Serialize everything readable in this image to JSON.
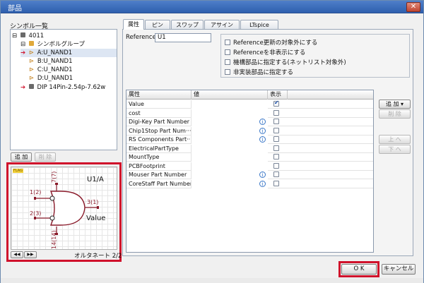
{
  "window": {
    "title": "部品",
    "close_label": "✕"
  },
  "left": {
    "symbol_list_label": "シンボル一覧",
    "tree": [
      {
        "text": "4011",
        "marker": "⊟",
        "icon_color": "#6a6a6a"
      },
      {
        "text": "シンボルグループ",
        "marker": "⊟",
        "icon_color": "#e0a93a"
      },
      {
        "text": "A:U_NAND1",
        "arrow": "➔",
        "selected": true
      },
      {
        "text": "B:U_NAND1"
      },
      {
        "text": "C:U_NAND1"
      },
      {
        "text": "D:U_NAND1"
      },
      {
        "text": "DIP 14Pin-2.54p-7.62w",
        "arrow": "➔"
      }
    ],
    "add_label": "追 加",
    "delete_label": "削 除",
    "preview": {
      "badge": "FLAG",
      "symbol_name": "U1/A",
      "value_label": "Value",
      "pin_top": "7(7)",
      "pin_in1": "1(2)",
      "pin_in2": "2(3)",
      "pin_out": "3(1)",
      "pin_bottom": "14(14)",
      "nav_prev": "◀◀",
      "nav_next": "▶▶",
      "alternate_label": "オルタネート 2/2"
    }
  },
  "tabs": [
    "属性",
    "ピン",
    "スワップ",
    "アサイン",
    "LTspice"
  ],
  "props": {
    "reference_label": "Reference",
    "reference_value": "U1",
    "options": [
      "Reference更新の対象外にする",
      "Referenceを非表示にする",
      "機構部品に指定する(ネットリスト対象外)",
      "非実装部品に指定する"
    ]
  },
  "grid": {
    "headers": [
      "属性",
      "値",
      "表示"
    ],
    "rows": [
      {
        "name": "Value",
        "info": false,
        "shown": true
      },
      {
        "name": "cost",
        "info": false,
        "shown": false
      },
      {
        "name": "Digi-Key Part Number",
        "info": true,
        "shown": false
      },
      {
        "name": "Chip1Stop Part Num···",
        "info": true,
        "shown": false
      },
      {
        "name": "RS Components Part···",
        "info": true,
        "shown": false
      },
      {
        "name": "ElectricalPartType",
        "info": false,
        "shown": false
      },
      {
        "name": "MountType",
        "info": false,
        "shown": false
      },
      {
        "name": "PCBFootprint",
        "info": false,
        "shown": false
      },
      {
        "name": "Mouser Part Number",
        "info": true,
        "shown": false
      },
      {
        "name": "CoreStaff Part Number",
        "info": true,
        "shown": false
      }
    ],
    "info_glyph": "i"
  },
  "side_buttons": {
    "add": "追 加 ▾",
    "delete": "削 除",
    "up": "上 へ",
    "down": "下 へ"
  },
  "footer": {
    "ok": "O K",
    "cancel": "キャンセル"
  }
}
